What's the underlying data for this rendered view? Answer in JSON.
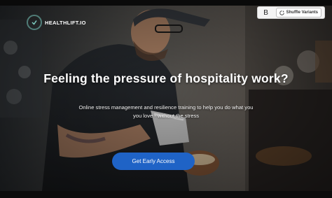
{
  "brand": {
    "name": "HEALTHLIFT.IO"
  },
  "hero": {
    "headline": "Feeling the pressure of hospitality work?",
    "subtext_line1": "Online stress management and resilience training to help you do what you",
    "subtext_line2": "you love - without the stress",
    "cta_label": "Get Early Access"
  },
  "toolbar": {
    "bold_label": "B",
    "shuffle_label": "Shuffle Variants"
  },
  "colors": {
    "cta": "#1f63c6",
    "text": "#ffffff"
  }
}
